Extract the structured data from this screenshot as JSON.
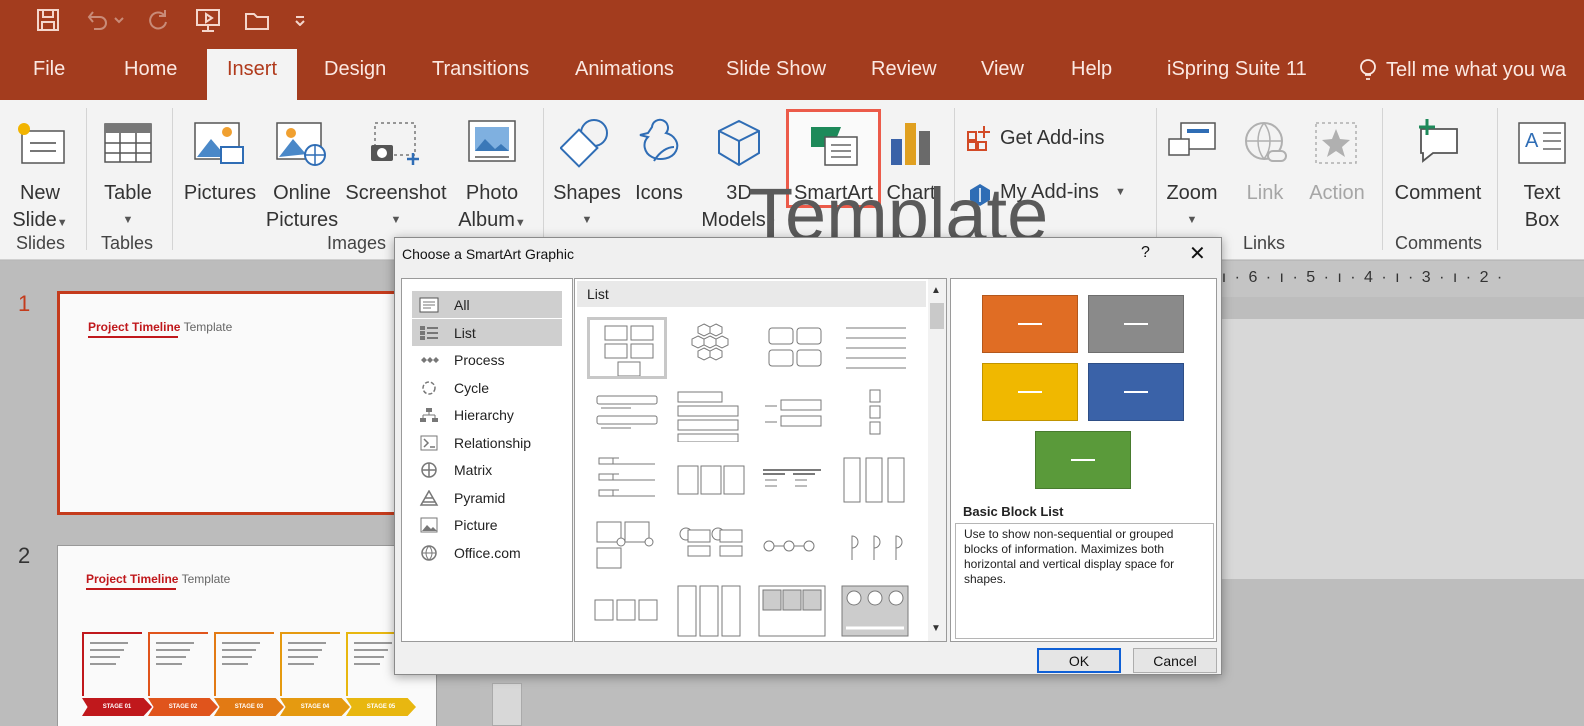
{
  "quick_access": {
    "icons": [
      "save-icon",
      "undo-icon",
      "undo-dropdown-icon",
      "redo-icon",
      "present-from-start-icon",
      "open-folder-icon",
      "customize-qat-icon"
    ]
  },
  "tabs": [
    {
      "label": "File",
      "active": false
    },
    {
      "label": "Home",
      "active": false
    },
    {
      "label": "Insert",
      "active": true
    },
    {
      "label": "Design",
      "active": false
    },
    {
      "label": "Transitions",
      "active": false
    },
    {
      "label": "Animations",
      "active": false
    },
    {
      "label": "Slide Show",
      "active": false
    },
    {
      "label": "Review",
      "active": false
    },
    {
      "label": "View",
      "active": false
    },
    {
      "label": "Help",
      "active": false
    },
    {
      "label": "iSpring Suite 11",
      "active": false
    }
  ],
  "tell_me": "Tell me what you wa",
  "ribbon": {
    "new_slide": [
      "New",
      "Slide"
    ],
    "table": "Table",
    "pictures": "Pictures",
    "online_pictures": [
      "Online",
      "Pictures"
    ],
    "screenshot": "Screenshot",
    "photo_album": [
      "Photo",
      "Album"
    ],
    "shapes": "Shapes",
    "icons": "Icons",
    "models_3d": [
      "3D",
      "Models"
    ],
    "smartart": "SmartArt",
    "chart": "Chart",
    "get_addins": "Get Add-ins",
    "my_addins": "My Add-ins",
    "zoom": "Zoom",
    "link": "Link",
    "action": "Action",
    "comment": "Comment",
    "text_box": [
      "Text",
      "Box"
    ],
    "groups": {
      "slides": "Slides",
      "tables": "Tables",
      "images": "Images",
      "links": "Links",
      "comments": "Comments"
    }
  },
  "slides_pane": {
    "slides": [
      {
        "number": "1",
        "title_red": "Project Timeline",
        "title_gray": " Template",
        "selected": true
      },
      {
        "number": "2",
        "title_red": "Project Timeline",
        "title_gray": " Template",
        "selected": false
      }
    ],
    "stage_labels": [
      "STAGE 01",
      "STAGE 02",
      "STAGE 03",
      "STAGE 04",
      "STAGE 05"
    ],
    "stage_colors": [
      "#c0181c",
      "#e0541c",
      "#e27a14",
      "#e59a10",
      "#e8b710"
    ]
  },
  "ruler": "· ı · 6 · ı · 5 · ı · 4 · ı · 3 · ı · 2 ·",
  "slide_main_title": "Template",
  "dialog": {
    "title": "Choose a SmartArt Graphic",
    "help": "?",
    "close": "✕",
    "categories": [
      {
        "label": "All",
        "icon": "all-icon",
        "selected": true
      },
      {
        "label": "List",
        "icon": "list-icon",
        "selected": true
      },
      {
        "label": "Process",
        "icon": "process-icon",
        "selected": false
      },
      {
        "label": "Cycle",
        "icon": "cycle-icon",
        "selected": false
      },
      {
        "label": "Hierarchy",
        "icon": "hierarchy-icon",
        "selected": false
      },
      {
        "label": "Relationship",
        "icon": "relationship-icon",
        "selected": false
      },
      {
        "label": "Matrix",
        "icon": "matrix-icon",
        "selected": false
      },
      {
        "label": "Pyramid",
        "icon": "pyramid-icon",
        "selected": false
      },
      {
        "label": "Picture",
        "icon": "picture-icon",
        "selected": false
      },
      {
        "label": "Office.com",
        "icon": "globe-icon",
        "selected": false
      }
    ],
    "gallery_heading": "List",
    "preview": {
      "name": "Basic Block List",
      "description": "Use to show non-sequential or grouped blocks of information. Maximizes both horizontal and vertical display space for shapes.",
      "block_colors": [
        "#e06d24",
        "#8a8a8a",
        "#f0b800",
        "#3a62a8",
        "#5a9a3a"
      ]
    },
    "ok": "OK",
    "cancel": "Cancel"
  }
}
